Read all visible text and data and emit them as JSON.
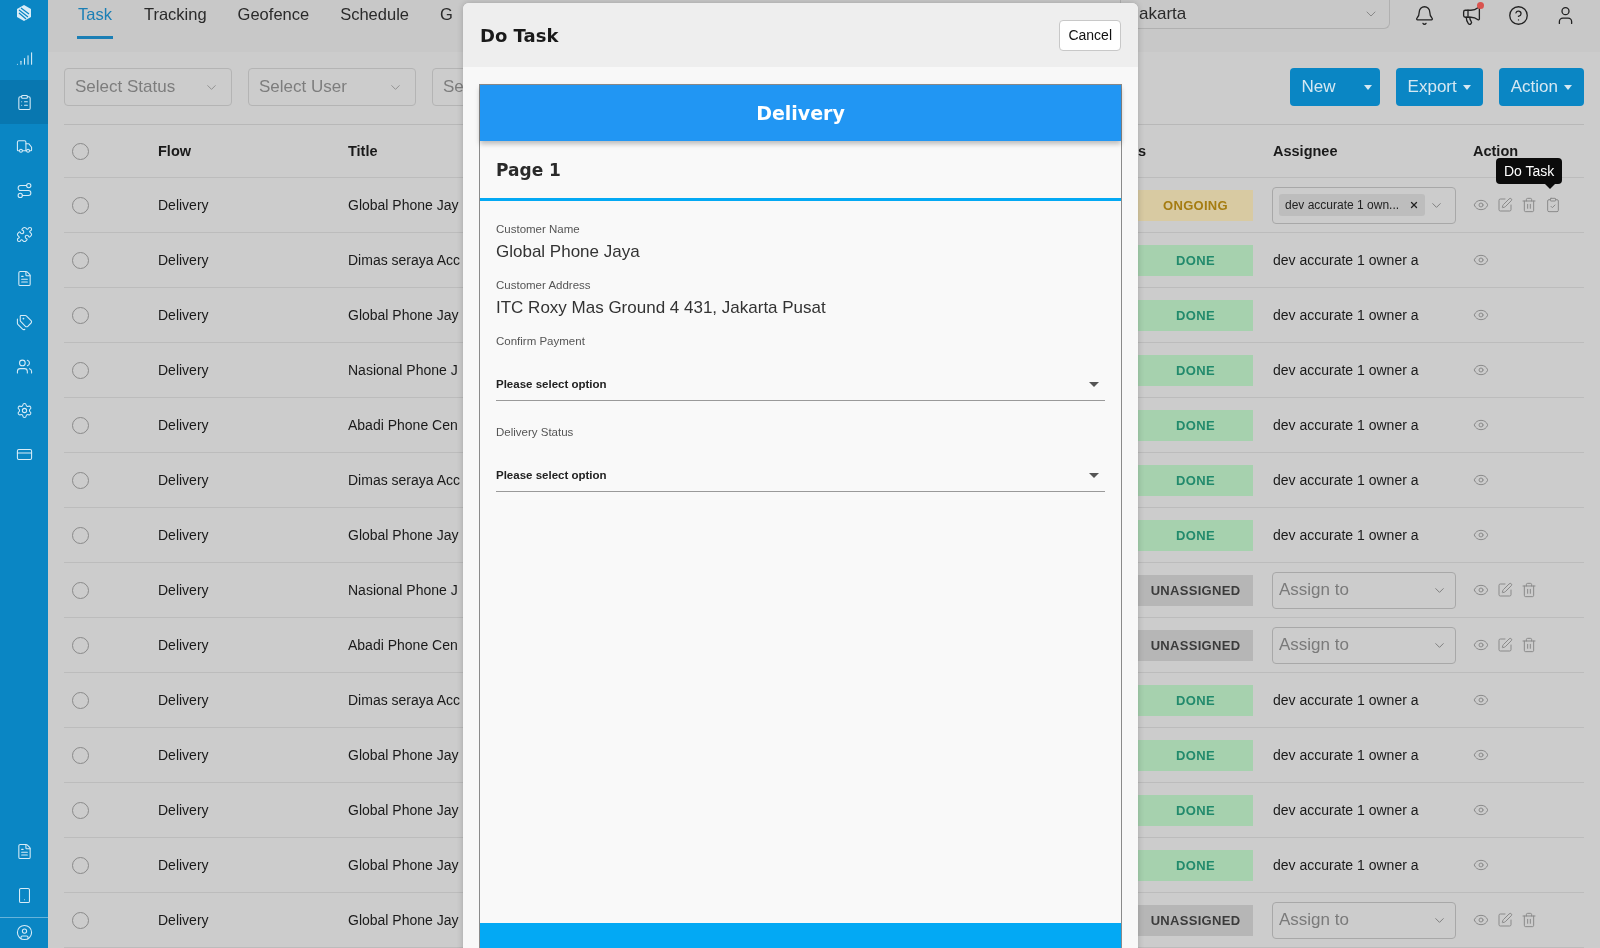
{
  "sidebar": {
    "items": [
      {
        "kind": "chart",
        "selected": false
      },
      {
        "kind": "clipboard",
        "selected": true
      },
      {
        "kind": "truck",
        "selected": false
      },
      {
        "kind": "route",
        "selected": false
      },
      {
        "kind": "puzzle",
        "selected": false
      },
      {
        "kind": "document",
        "selected": false
      },
      {
        "kind": "tags",
        "selected": false
      },
      {
        "kind": "users",
        "selected": false
      },
      {
        "kind": "settings",
        "selected": false
      },
      {
        "kind": "card",
        "selected": false
      }
    ],
    "bottom_items": [
      {
        "kind": "document",
        "selected": false
      },
      {
        "kind": "phone",
        "selected": false
      }
    ]
  },
  "tabs": [
    {
      "label": "Task",
      "selected": true
    },
    {
      "label": "Tracking",
      "selected": false
    },
    {
      "label": "Geofence",
      "selected": false
    },
    {
      "label": "Schedule",
      "selected": false
    },
    {
      "label": "G",
      "selected": false
    }
  ],
  "location_select": {
    "value": "akarta"
  },
  "notifications": {
    "unread": true
  },
  "filters": [
    {
      "placeholder": "Select Status"
    },
    {
      "placeholder": "Select User"
    },
    {
      "placeholder": "Se"
    }
  ],
  "buttons": [
    {
      "label": "New",
      "kind": "split"
    },
    {
      "label": "Export",
      "kind": "dropdown"
    },
    {
      "label": "Action",
      "kind": "dropdown"
    }
  ],
  "table": {
    "select_all": {
      "checked": false
    },
    "columns": [
      "Flow",
      "Title",
      "s",
      "Assignee",
      "Action"
    ],
    "rows": [
      {
        "checked": false,
        "flow": "Delivery",
        "title": "Global Phone Jay",
        "status": {
          "label": "ONGOING",
          "kind": "ongoing"
        },
        "assignee": {
          "kind": "tag",
          "text": "dev accurate 1 own..."
        },
        "actions": [
          {
            "kind": "view"
          },
          {
            "kind": "edit"
          },
          {
            "kind": "delete"
          },
          {
            "kind": "do_task"
          }
        ],
        "tooltip": "Do Task"
      },
      {
        "checked": false,
        "flow": "Delivery",
        "title": "Dimas seraya Acc",
        "status": {
          "label": "DONE",
          "kind": "done"
        },
        "assignee": {
          "kind": "text",
          "text": "dev accurate 1 owner a"
        },
        "actions": [
          {
            "kind": "view"
          }
        ]
      },
      {
        "checked": false,
        "flow": "Delivery",
        "title": "Global Phone Jay",
        "status": {
          "label": "DONE",
          "kind": "done"
        },
        "assignee": {
          "kind": "text",
          "text": "dev accurate 1 owner a"
        },
        "actions": [
          {
            "kind": "view"
          }
        ]
      },
      {
        "checked": false,
        "flow": "Delivery",
        "title": "Nasional Phone J",
        "status": {
          "label": "DONE",
          "kind": "done"
        },
        "assignee": {
          "kind": "text",
          "text": "dev accurate 1 owner a"
        },
        "actions": [
          {
            "kind": "view"
          }
        ]
      },
      {
        "checked": false,
        "flow": "Delivery",
        "title": "Abadi Phone Cen",
        "status": {
          "label": "DONE",
          "kind": "done"
        },
        "assignee": {
          "kind": "text",
          "text": "dev accurate 1 owner a"
        },
        "actions": [
          {
            "kind": "view"
          }
        ]
      },
      {
        "checked": false,
        "flow": "Delivery",
        "title": "Dimas seraya Acc",
        "status": {
          "label": "DONE",
          "kind": "done"
        },
        "assignee": {
          "kind": "text",
          "text": "dev accurate 1 owner a"
        },
        "actions": [
          {
            "kind": "view"
          }
        ]
      },
      {
        "checked": false,
        "flow": "Delivery",
        "title": "Global Phone Jay",
        "status": {
          "label": "DONE",
          "kind": "done"
        },
        "assignee": {
          "kind": "text",
          "text": "dev accurate 1 owner a"
        },
        "actions": [
          {
            "kind": "view"
          }
        ]
      },
      {
        "checked": false,
        "flow": "Delivery",
        "title": "Nasional Phone J",
        "status": {
          "label": "UNASSIGNED",
          "kind": "unassigned"
        },
        "assignee": {
          "kind": "select",
          "text": "Assign to"
        },
        "actions": [
          {
            "kind": "view"
          },
          {
            "kind": "edit"
          },
          {
            "kind": "delete"
          }
        ]
      },
      {
        "checked": false,
        "flow": "Delivery",
        "title": "Abadi Phone Cen",
        "status": {
          "label": "UNASSIGNED",
          "kind": "unassigned"
        },
        "assignee": {
          "kind": "select",
          "text": "Assign to"
        },
        "actions": [
          {
            "kind": "view"
          },
          {
            "kind": "edit"
          },
          {
            "kind": "delete"
          }
        ]
      },
      {
        "checked": false,
        "flow": "Delivery",
        "title": "Dimas seraya Acc",
        "status": {
          "label": "DONE",
          "kind": "done"
        },
        "assignee": {
          "kind": "text",
          "text": "dev accurate 1 owner a"
        },
        "actions": [
          {
            "kind": "view"
          }
        ]
      },
      {
        "checked": false,
        "flow": "Delivery",
        "title": "Global Phone Jay",
        "status": {
          "label": "DONE",
          "kind": "done"
        },
        "assignee": {
          "kind": "text",
          "text": "dev accurate 1 owner a"
        },
        "actions": [
          {
            "kind": "view"
          }
        ]
      },
      {
        "checked": false,
        "flow": "Delivery",
        "title": "Global Phone Jay",
        "status": {
          "label": "DONE",
          "kind": "done"
        },
        "assignee": {
          "kind": "text",
          "text": "dev accurate 1 owner a"
        },
        "actions": [
          {
            "kind": "view"
          }
        ]
      },
      {
        "checked": false,
        "flow": "Delivery",
        "title": "Global Phone Jay",
        "status": {
          "label": "DONE",
          "kind": "done"
        },
        "assignee": {
          "kind": "text",
          "text": "dev accurate 1 owner a"
        },
        "actions": [
          {
            "kind": "view"
          }
        ]
      },
      {
        "checked": false,
        "flow": "Delivery",
        "title": "Global Phone Jay",
        "status": {
          "label": "UNASSIGNED",
          "kind": "unassigned"
        },
        "assignee": {
          "kind": "select",
          "text": "Assign to"
        },
        "actions": [
          {
            "kind": "view"
          },
          {
            "kind": "edit"
          },
          {
            "kind": "delete"
          }
        ]
      }
    ]
  },
  "modal": {
    "title": "Do Task",
    "cancel": "Cancel",
    "form_title": "Delivery",
    "page_title": "Page 1",
    "fields": [
      {
        "kind": "readonly",
        "label": "Customer Name",
        "value": "Global Phone Jaya"
      },
      {
        "kind": "readonly",
        "label": "Customer Address",
        "value": "ITC Roxy Mas Ground 4 431, Jakarta Pusat"
      },
      {
        "kind": "select",
        "label": "Confirm Payment",
        "placeholder": "Please select option"
      },
      {
        "kind": "select",
        "label": "Delivery Status",
        "placeholder": "Please select option"
      }
    ]
  }
}
